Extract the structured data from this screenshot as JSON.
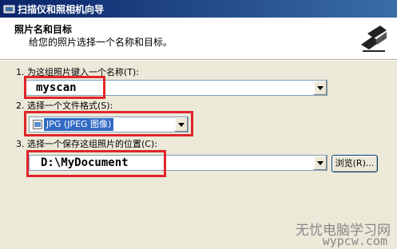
{
  "window": {
    "title": "扫描仪和照相机向导",
    "icon": "wizard-icon"
  },
  "header": {
    "title": "照片名和目标",
    "subtitle": "给您的照片选择一个名称和目标。",
    "logo": "camera-scanner-logo-icon"
  },
  "step1": {
    "label": "1. 为这组照片键入一个名称(T):",
    "value": "myscan"
  },
  "step2": {
    "label": "2. 选择一个文件格式(S):",
    "value": "JPG (JPEG 图像)",
    "icon": "jpg-file-icon"
  },
  "step3": {
    "label": "3. 选择一个保存这组照片的位置(C):",
    "value": "D:\\MyDocument",
    "browse_label": "浏览(R)..."
  },
  "watermark": {
    "line1": "无忧电脑学习网",
    "line2": "wypcw.com"
  },
  "colors": {
    "titlebar_start": "#0a246a",
    "titlebar_end": "#3a6ea5",
    "highlight": "#e0252b",
    "selection": "#316ac5",
    "background": "#ece9d8"
  }
}
